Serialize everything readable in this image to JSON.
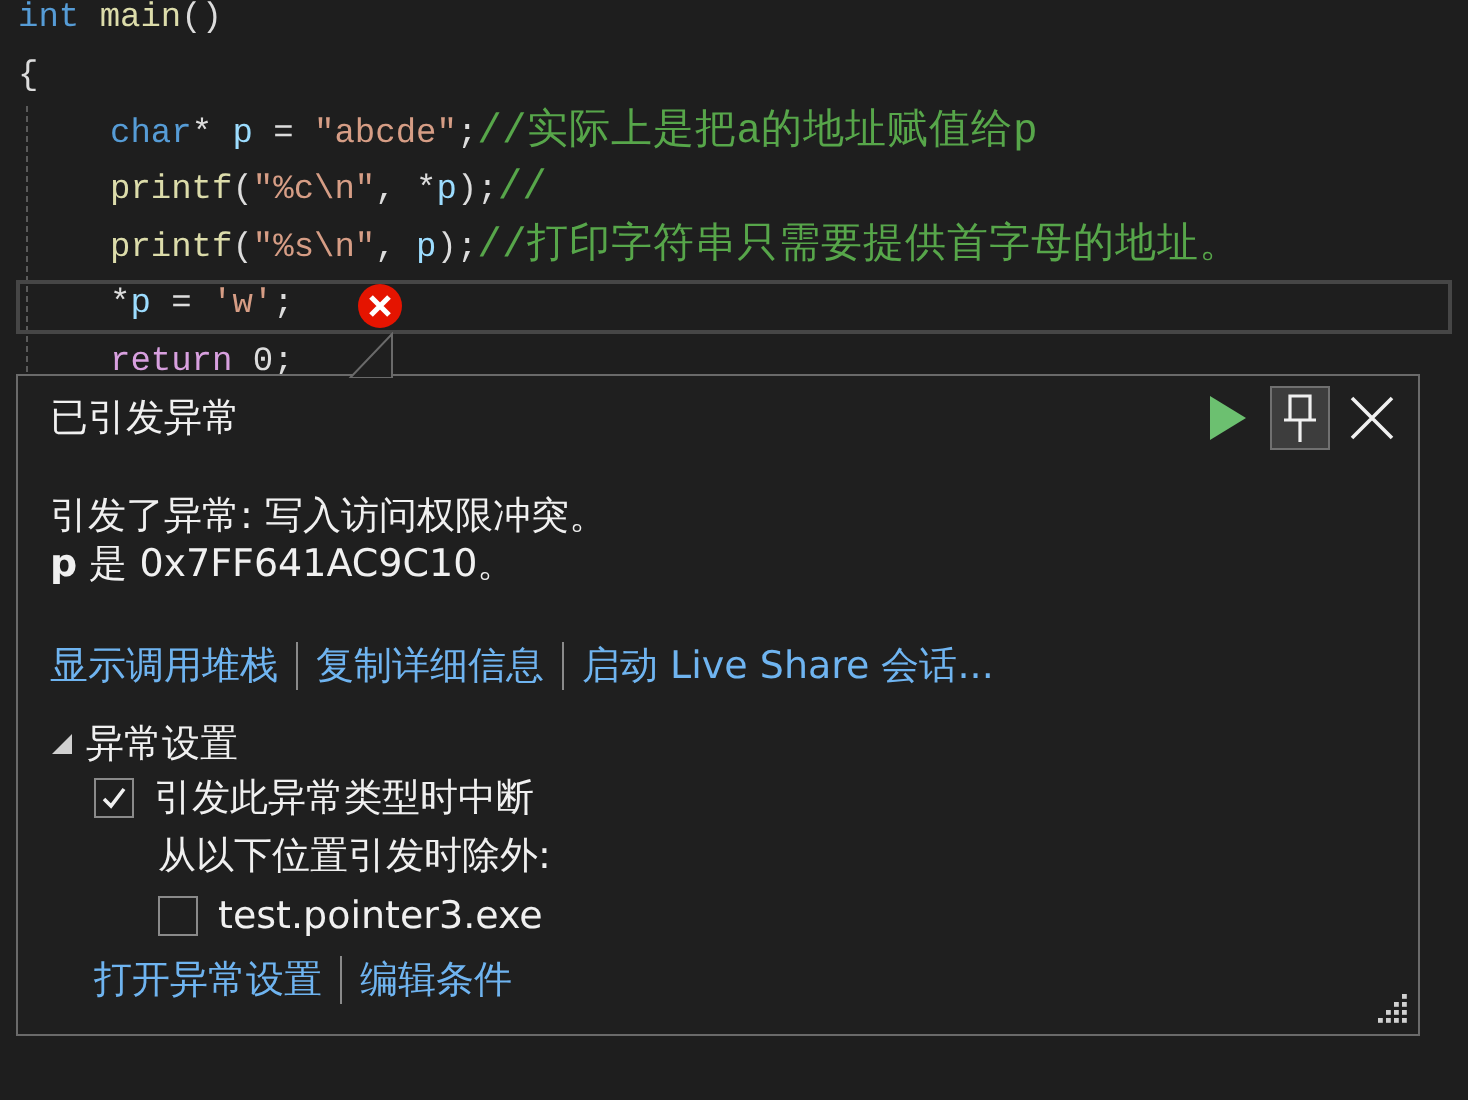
{
  "code": {
    "lines": [
      {
        "tokens": [
          {
            "kind": "keyword",
            "text": "int "
          },
          {
            "kind": "function",
            "text": "main"
          },
          {
            "kind": "plain",
            "text": "()"
          }
        ]
      },
      {
        "tokens": [
          {
            "kind": "plain",
            "text": "{"
          }
        ],
        "children": [
          {
            "current": false,
            "error": false,
            "tokens": [
              {
                "kind": "keyword",
                "text": "char"
              },
              {
                "kind": "plain",
                "text": "* "
              },
              {
                "kind": "variable",
                "text": "p"
              },
              {
                "kind": "plain",
                "text": " = "
              },
              {
                "kind": "string",
                "text": "\"abcde\""
              },
              {
                "kind": "plain",
                "text": ";"
              },
              {
                "kind": "comment",
                "text": "//实际上是把a的地址赋值给p"
              }
            ]
          },
          {
            "current": false,
            "error": false,
            "tokens": [
              {
                "kind": "function",
                "text": "printf"
              },
              {
                "kind": "plain",
                "text": "("
              },
              {
                "kind": "string",
                "text": "\"%c\\n\""
              },
              {
                "kind": "plain",
                "text": ", *"
              },
              {
                "kind": "variable",
                "text": "p"
              },
              {
                "kind": "plain",
                "text": ");"
              },
              {
                "kind": "comment",
                "text": "//"
              }
            ]
          },
          {
            "current": false,
            "error": false,
            "tokens": [
              {
                "kind": "function",
                "text": "printf"
              },
              {
                "kind": "plain",
                "text": "("
              },
              {
                "kind": "string",
                "text": "\"%s\\n\""
              },
              {
                "kind": "plain",
                "text": ", "
              },
              {
                "kind": "variable",
                "text": "p"
              },
              {
                "kind": "plain",
                "text": ");"
              },
              {
                "kind": "comment",
                "text": "//打印字符串只需要提供首字母的地址。"
              }
            ]
          },
          {
            "current": true,
            "error": true,
            "tokens": [
              {
                "kind": "plain",
                "text": "*"
              },
              {
                "kind": "variable",
                "text": "p"
              },
              {
                "kind": "plain",
                "text": " = "
              },
              {
                "kind": "string",
                "text": "'w'"
              },
              {
                "kind": "plain",
                "text": ";"
              }
            ]
          },
          {
            "current": false,
            "error": false,
            "tokens": [
              {
                "kind": "control",
                "text": "return"
              },
              {
                "kind": "plain",
                "text": " 0;"
              }
            ]
          }
        ]
      }
    ]
  },
  "exception_popup": {
    "title": "已引发异常",
    "message": [
      "引发了异常: 写入访问权限冲突。",
      "**p** 是 0x7FF641AC9C10。"
    ],
    "links": [
      "显示调用堆栈",
      "复制详细信息",
      "启动 Live Share 会话..."
    ],
    "settings": {
      "label": "异常设置",
      "expanded": true,
      "break_option": {
        "label": "引发此异常类型时中断",
        "checked": true
      },
      "except_note": "从以下位置引发时除外:",
      "exceptions": [
        {
          "label": "test.pointer3.exe",
          "checked": false
        }
      ],
      "links": [
        "打开异常设置",
        "编辑条件"
      ]
    }
  }
}
